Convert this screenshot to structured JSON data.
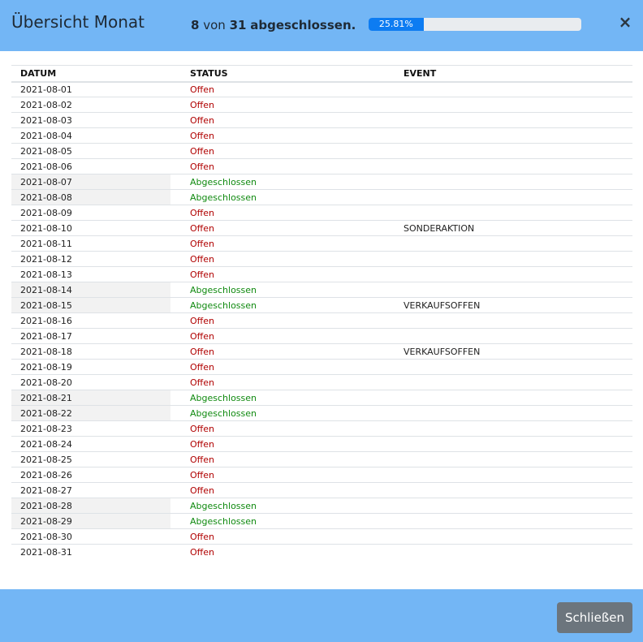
{
  "header": {
    "title": "Übersicht Monat",
    "done_count": "8",
    "von": "von",
    "total_count": "31",
    "done_label": "abgeschlossen.",
    "progress_text": "25.81%",
    "progress_value": 25.81,
    "close_symbol": "×"
  },
  "table": {
    "columns": [
      "DATUM",
      "STATUS",
      "EVENT"
    ],
    "rows": [
      {
        "date": "2021-08-01",
        "status": "Offen",
        "event": ""
      },
      {
        "date": "2021-08-02",
        "status": "Offen",
        "event": ""
      },
      {
        "date": "2021-08-03",
        "status": "Offen",
        "event": ""
      },
      {
        "date": "2021-08-04",
        "status": "Offen",
        "event": ""
      },
      {
        "date": "2021-08-05",
        "status": "Offen",
        "event": ""
      },
      {
        "date": "2021-08-06",
        "status": "Offen",
        "event": ""
      },
      {
        "date": "2021-08-07",
        "status": "Abgeschlossen",
        "event": ""
      },
      {
        "date": "2021-08-08",
        "status": "Abgeschlossen",
        "event": ""
      },
      {
        "date": "2021-08-09",
        "status": "Offen",
        "event": ""
      },
      {
        "date": "2021-08-10",
        "status": "Offen",
        "event": "SONDERAKTION"
      },
      {
        "date": "2021-08-11",
        "status": "Offen",
        "event": ""
      },
      {
        "date": "2021-08-12",
        "status": "Offen",
        "event": ""
      },
      {
        "date": "2021-08-13",
        "status": "Offen",
        "event": ""
      },
      {
        "date": "2021-08-14",
        "status": "Abgeschlossen",
        "event": ""
      },
      {
        "date": "2021-08-15",
        "status": "Abgeschlossen",
        "event": "VERKAUFSOFFEN"
      },
      {
        "date": "2021-08-16",
        "status": "Offen",
        "event": ""
      },
      {
        "date": "2021-08-17",
        "status": "Offen",
        "event": ""
      },
      {
        "date": "2021-08-18",
        "status": "Offen",
        "event": "VERKAUFSOFFEN"
      },
      {
        "date": "2021-08-19",
        "status": "Offen",
        "event": ""
      },
      {
        "date": "2021-08-20",
        "status": "Offen",
        "event": ""
      },
      {
        "date": "2021-08-21",
        "status": "Abgeschlossen",
        "event": ""
      },
      {
        "date": "2021-08-22",
        "status": "Abgeschlossen",
        "event": ""
      },
      {
        "date": "2021-08-23",
        "status": "Offen",
        "event": ""
      },
      {
        "date": "2021-08-24",
        "status": "Offen",
        "event": ""
      },
      {
        "date": "2021-08-25",
        "status": "Offen",
        "event": ""
      },
      {
        "date": "2021-08-26",
        "status": "Offen",
        "event": ""
      },
      {
        "date": "2021-08-27",
        "status": "Offen",
        "event": ""
      },
      {
        "date": "2021-08-28",
        "status": "Abgeschlossen",
        "event": ""
      },
      {
        "date": "2021-08-29",
        "status": "Abgeschlossen",
        "event": ""
      },
      {
        "date": "2021-08-30",
        "status": "Offen",
        "event": ""
      },
      {
        "date": "2021-08-31",
        "status": "Offen",
        "event": ""
      }
    ]
  },
  "footer": {
    "close_label": "Schließen"
  },
  "colors": {
    "header_bg": "#73b6f5",
    "progress_fill": "#0d7cf2",
    "status_open": "#b00000",
    "status_done": "#108a10",
    "button_bg": "#6c757d"
  }
}
